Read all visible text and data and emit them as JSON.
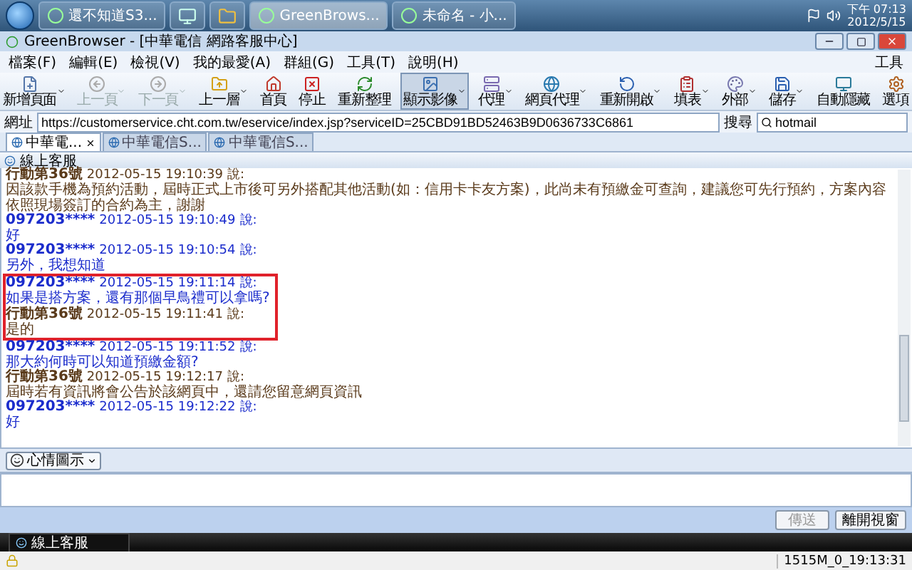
{
  "taskbar": {
    "tasks": [
      {
        "label": "還不知道S3...",
        "selected": false
      },
      {
        "selected": false
      },
      {
        "selected": false
      },
      {
        "label": "GreenBrows...",
        "selected": true
      },
      {
        "label": "未命名 - 小...",
        "selected": false
      }
    ],
    "time": "下午 07:13",
    "date": "2012/5/15"
  },
  "window": {
    "title": "GreenBrowser - [中華電信 網路客服中心]"
  },
  "menu": [
    "檔案(F)",
    "編輯(E)",
    "檢視(V)",
    "我的最愛(A)",
    "群組(G)",
    "工具(T)",
    "說明(H)"
  ],
  "tools_label": "工具",
  "toolbar": [
    {
      "label": "新增頁面",
      "disabled": false,
      "dropdown": true,
      "pressed": false
    },
    {
      "label": "上一頁",
      "disabled": true,
      "dropdown": true,
      "pressed": false
    },
    {
      "label": "下一頁",
      "disabled": true,
      "dropdown": true,
      "pressed": false
    },
    {
      "label": "上一層",
      "disabled": false,
      "dropdown": true,
      "pressed": false
    },
    {
      "label": "首頁",
      "disabled": false,
      "dropdown": false,
      "pressed": false
    },
    {
      "label": "停止",
      "disabled": false,
      "dropdown": false,
      "pressed": false
    },
    {
      "label": "重新整理",
      "disabled": false,
      "dropdown": false,
      "pressed": false
    },
    {
      "label": "顯示影像",
      "disabled": false,
      "dropdown": true,
      "pressed": true
    },
    {
      "label": "代理",
      "disabled": false,
      "dropdown": true,
      "pressed": false
    },
    {
      "label": "網頁代理",
      "disabled": false,
      "dropdown": true,
      "pressed": false
    },
    {
      "label": "重新開啟",
      "disabled": false,
      "dropdown": true,
      "pressed": false
    },
    {
      "label": "填表",
      "disabled": false,
      "dropdown": true,
      "pressed": false
    },
    {
      "label": "外部",
      "disabled": false,
      "dropdown": true,
      "pressed": false
    },
    {
      "label": "儲存",
      "disabled": false,
      "dropdown": true,
      "pressed": false
    },
    {
      "label": "自動隱藏",
      "disabled": false,
      "dropdown": false,
      "pressed": false
    },
    {
      "label": "選項",
      "disabled": false,
      "dropdown": false,
      "pressed": false
    }
  ],
  "address": {
    "label": "網址",
    "url": "https://customerservice.cht.com.tw/eservice/index.jsp?serviceID=25CBD91BD52463B9D0636733C6861"
  },
  "search": {
    "label": "搜尋",
    "value": "hotmail"
  },
  "tabs": [
    {
      "label": "中華電...",
      "selected": true
    },
    {
      "label": "中華電信S...",
      "selected": false
    },
    {
      "label": "中華電信S...",
      "selected": false
    }
  ],
  "chat": {
    "title": "線上客服",
    "messages": [
      {
        "kind": "agent",
        "name": "行動第36號",
        "time": "2012-05-15 19:10:39",
        "said": "說:",
        "text": "因該款手機為預約活動，屆時正式上市後可另外搭配其他活動(如：信用卡卡友方案)，此尚未有預繳金可查詢，建議您可先行預約，方案內容依照現場簽訂的合約為主，謝謝",
        "highlighted": false
      },
      {
        "kind": "customer",
        "name": "097203****",
        "time": "2012-05-15 19:10:49",
        "said": "說:",
        "text": "好",
        "highlighted": false
      },
      {
        "kind": "customer",
        "name": "097203****",
        "time": "2012-05-15 19:10:54",
        "said": "說:",
        "text": "另外，我想知道",
        "highlighted": false
      },
      {
        "kind": "customer",
        "name": "097203****",
        "time": "2012-05-15 19:11:14",
        "said": "說:",
        "text": "如果是搭方案，還有那個早鳥禮可以拿嗎?",
        "highlighted": true
      },
      {
        "kind": "agent",
        "name": "行動第36號",
        "time": "2012-05-15 19:11:41",
        "said": "說:",
        "text": "是的",
        "highlighted": true
      },
      {
        "kind": "customer",
        "name": "097203****",
        "time": "2012-05-15 19:11:52",
        "said": "說:",
        "text": "那大約何時可以知道預繳金額?",
        "highlighted": false
      },
      {
        "kind": "agent",
        "name": "行動第36號",
        "time": "2012-05-15 19:12:17",
        "said": "說:",
        "text": "屆時若有資訊將會公告於該網頁中，還請您留意網頁資訊",
        "highlighted": false
      },
      {
        "kind": "customer",
        "name": "097203****",
        "time": "2012-05-15 19:12:22",
        "said": "說:",
        "text": "好",
        "highlighted": false
      }
    ],
    "mood_button": "心情圖示",
    "buttons": [
      {
        "label": "傳送",
        "disabled": true
      },
      {
        "label": "離開視窗",
        "disabled": false
      }
    ],
    "bottom_tab": "線上客服"
  },
  "status_bar": {
    "text": "1515M_0_19:13:31"
  }
}
